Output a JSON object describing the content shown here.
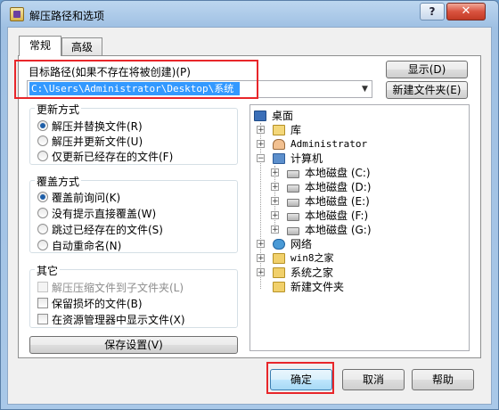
{
  "window": {
    "title": "解压路径和选项",
    "help_label": "?",
    "close_label": "✕"
  },
  "tabs": [
    {
      "label": "常规",
      "active": true
    },
    {
      "label": "高级",
      "active": false
    }
  ],
  "destination": {
    "label": "目标路径(如果不存在将被创建)(P)",
    "value": "C:\\Users\\Administrator\\Desktop\\系统之家"
  },
  "side_buttons": {
    "show": "显示(D)",
    "new_folder": "新建文件夹(E)"
  },
  "update_mode": {
    "title": "更新方式",
    "options": [
      {
        "label": "解压并替换文件(R)",
        "selected": true
      },
      {
        "label": "解压并更新文件(U)",
        "selected": false
      },
      {
        "label": "仅更新已经存在的文件(F)",
        "selected": false
      }
    ]
  },
  "overwrite_mode": {
    "title": "覆盖方式",
    "options": [
      {
        "label": "覆盖前询问(K)",
        "selected": true
      },
      {
        "label": "没有提示直接覆盖(W)",
        "selected": false
      },
      {
        "label": "跳过已经存在的文件(S)",
        "selected": false
      },
      {
        "label": "自动重命名(N)",
        "selected": false
      }
    ]
  },
  "misc": {
    "title": "其它",
    "options": [
      {
        "label": "解压压缩文件到子文件夹(L)",
        "checked": false,
        "disabled": true
      },
      {
        "label": "保留损坏的文件(B)",
        "checked": false,
        "disabled": false
      },
      {
        "label": "在资源管理器中显示文件(X)",
        "checked": false,
        "disabled": false
      }
    ]
  },
  "save_settings": "保存设置(V)",
  "tree": {
    "root": "桌面",
    "items": [
      {
        "label": "库",
        "icon": "library-icon",
        "expander": "+"
      },
      {
        "label": "Administrator",
        "icon": "user-folder-icon",
        "expander": "+"
      },
      {
        "label": "计算机",
        "icon": "computer-icon",
        "expander": "−"
      },
      {
        "label": "本地磁盘 (C:)",
        "icon": "drive-icon",
        "expander": "+"
      },
      {
        "label": "本地磁盘 (D:)",
        "icon": "drive-icon",
        "expander": "+"
      },
      {
        "label": "本地磁盘 (E:)",
        "icon": "drive-icon",
        "expander": "+"
      },
      {
        "label": "本地磁盘 (F:)",
        "icon": "drive-icon",
        "expander": "+"
      },
      {
        "label": "本地磁盘 (G:)",
        "icon": "drive-icon",
        "expander": "+"
      },
      {
        "label": "网络",
        "icon": "network-icon",
        "expander": "+"
      },
      {
        "label": "win8之家",
        "icon": "folder-icon",
        "expander": "+"
      },
      {
        "label": "系统之家",
        "icon": "folder-icon",
        "expander": "+"
      },
      {
        "label": "新建文件夹",
        "icon": "folder-icon",
        "expander": ""
      }
    ]
  },
  "footer": {
    "ok": "确定",
    "cancel": "取消",
    "help": "帮助"
  },
  "colors": {
    "highlight": "#3399ff",
    "annotation_red": "#e8262a"
  }
}
